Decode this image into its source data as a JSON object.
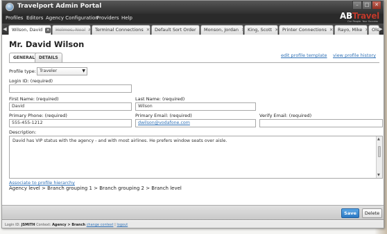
{
  "window": {
    "title": "Travelport Admin Portal"
  },
  "menubar": {
    "items": [
      "Profiles",
      "Editors",
      "Agency Configuration",
      "Providers",
      "Help"
    ]
  },
  "brand": {
    "name_a": "AB",
    "name_b": "Travel",
    "tagline": "Our People. Your Success"
  },
  "tabs": [
    {
      "label": "Wilson, David",
      "active": true
    },
    {
      "label": "Helmes, Neal"
    },
    {
      "label": "Terminal Connections"
    },
    {
      "label": "Default Sort Order"
    },
    {
      "label": "Monson, Jordan"
    },
    {
      "label": "King, Scott"
    },
    {
      "label": "Printer Connections"
    },
    {
      "label": "Rayo, Mike"
    },
    {
      "label": "Olse"
    }
  ],
  "page": {
    "title": "Mr. David Wilson",
    "subtabs": [
      "GENERAL",
      "DETAILS"
    ],
    "links": {
      "edit_template": "edit profile template",
      "view_history": "view profile history"
    }
  },
  "form": {
    "profile_type": {
      "label": "Profile type:",
      "value": "Traveler"
    },
    "login_id": {
      "label": "Login ID: (required)",
      "value": ""
    },
    "first_name": {
      "label": "First Name: (required)",
      "value": "David"
    },
    "last_name": {
      "label": "Last Name: (required)",
      "value": "Wilson"
    },
    "primary_phone": {
      "label": "Primary Phone: (required)",
      "value": "555-455-1212"
    },
    "primary_email": {
      "label": "Primary Email: (required)",
      "value": "dwilson@vodafone.com"
    },
    "verify_email": {
      "label": "Verify Email: (required)",
      "value": ""
    },
    "description": {
      "label": "Description:",
      "value": "David has VIP status with the agency - and with most airlines.  He prefers window seats over aisle."
    }
  },
  "hierarchy": {
    "link": "Associate to profile hierarchy",
    "path": "Agency level > Branch grouping 1 > Branch grouping 2 > Branch level"
  },
  "actions": {
    "save": "Save",
    "delete": "Delete"
  },
  "status": {
    "login_label": "Login ID:",
    "login_value": "JSMITH",
    "context_label": "Context:",
    "context_value": "Agency > Branch",
    "change_context": "change context",
    "logout": "logout"
  },
  "colors": {
    "accent": "#2d6fb5",
    "save": "#2b78c2",
    "titlebar": "#3a3a3a",
    "brand_red": "#c0392b"
  }
}
